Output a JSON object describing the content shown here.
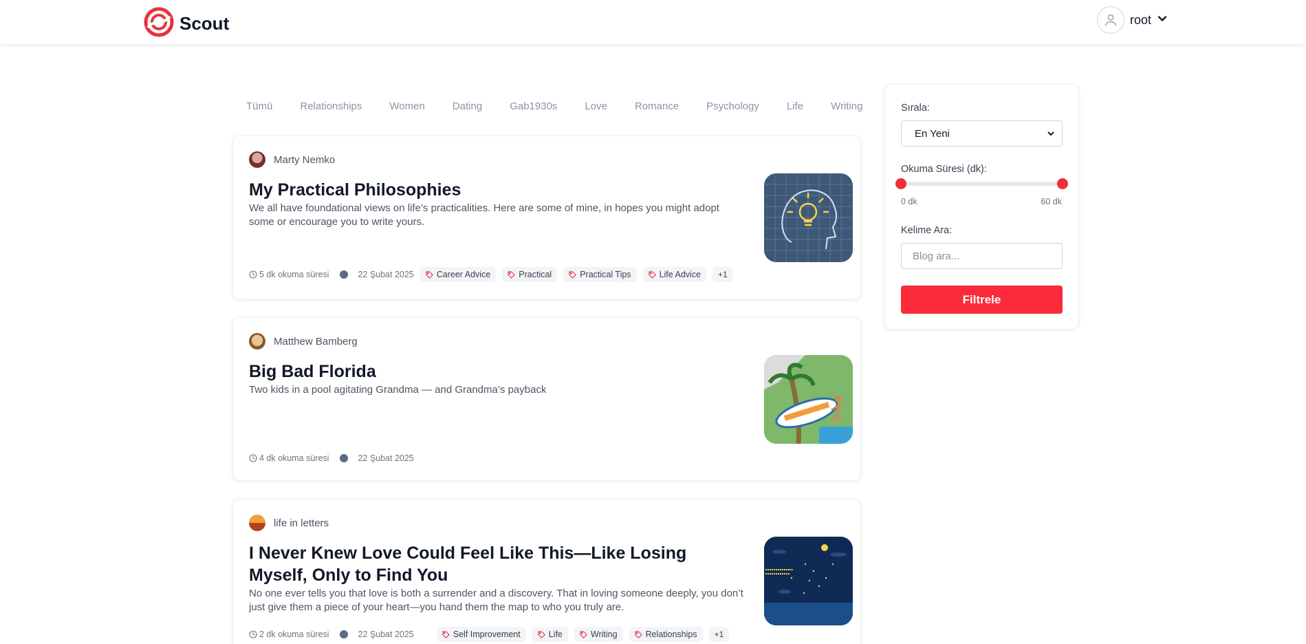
{
  "header": {
    "brand_name": "Scout",
    "user_name": "root",
    "brand_color": "#e8313d"
  },
  "category_tabs": [
    "Tümü",
    "Relationships",
    "Women",
    "Dating",
    "Gab1930s",
    "Love",
    "Romance",
    "Psychology",
    "Life",
    "Writing"
  ],
  "posts": [
    {
      "author": "Marty Nemko",
      "title": "My Practical Philosophies",
      "description": "We all have foundational views on life’s practicalities. Here are some of mine, in hopes you might adopt some or encourage you to write yours.",
      "read_time": "5 dk okuma süresi",
      "date": "22 Şubat 2025",
      "tags": [
        "Career Advice",
        "Practical",
        "Practical Tips",
        "Life Advice"
      ],
      "more_tags": "+1"
    },
    {
      "author": "Matthew Bamberg",
      "title": "Big Bad Florida",
      "description": "Two kids in a pool agitating Grandma — and Grandma’s payback",
      "read_time": "4 dk okuma süresi",
      "date": "22 Şubat 2025",
      "tags": [],
      "more_tags": ""
    },
    {
      "author": "life in letters",
      "title": "I Never Knew Love Could Feel Like This—Like Losing Myself, Only to Find You",
      "description": "No one ever tells you that love is both a surrender and a discovery. That in loving someone deeply, you don’t just give them a piece of your heart—you hand them the map to who you truly are.",
      "read_time": "2 dk okuma süresi",
      "date": "22 Şubat 2025",
      "tags": [
        "Self Improvement",
        "Life",
        "Writing",
        "Relationships"
      ],
      "more_tags": "+1"
    }
  ],
  "filters": {
    "sort_label": "Sırala:",
    "sort_value": "En Yeni",
    "reading_time_label": "Okuma Süresi (dk):",
    "reading_time_min": "0 dk",
    "reading_time_max": "60 dk",
    "reading_time_range": [
      0,
      60
    ],
    "keyword_label": "Kelime Ara:",
    "keyword_placeholder": "Blog ara...",
    "filter_button": "Filtrele",
    "accent_color": "#fb2b3b"
  }
}
